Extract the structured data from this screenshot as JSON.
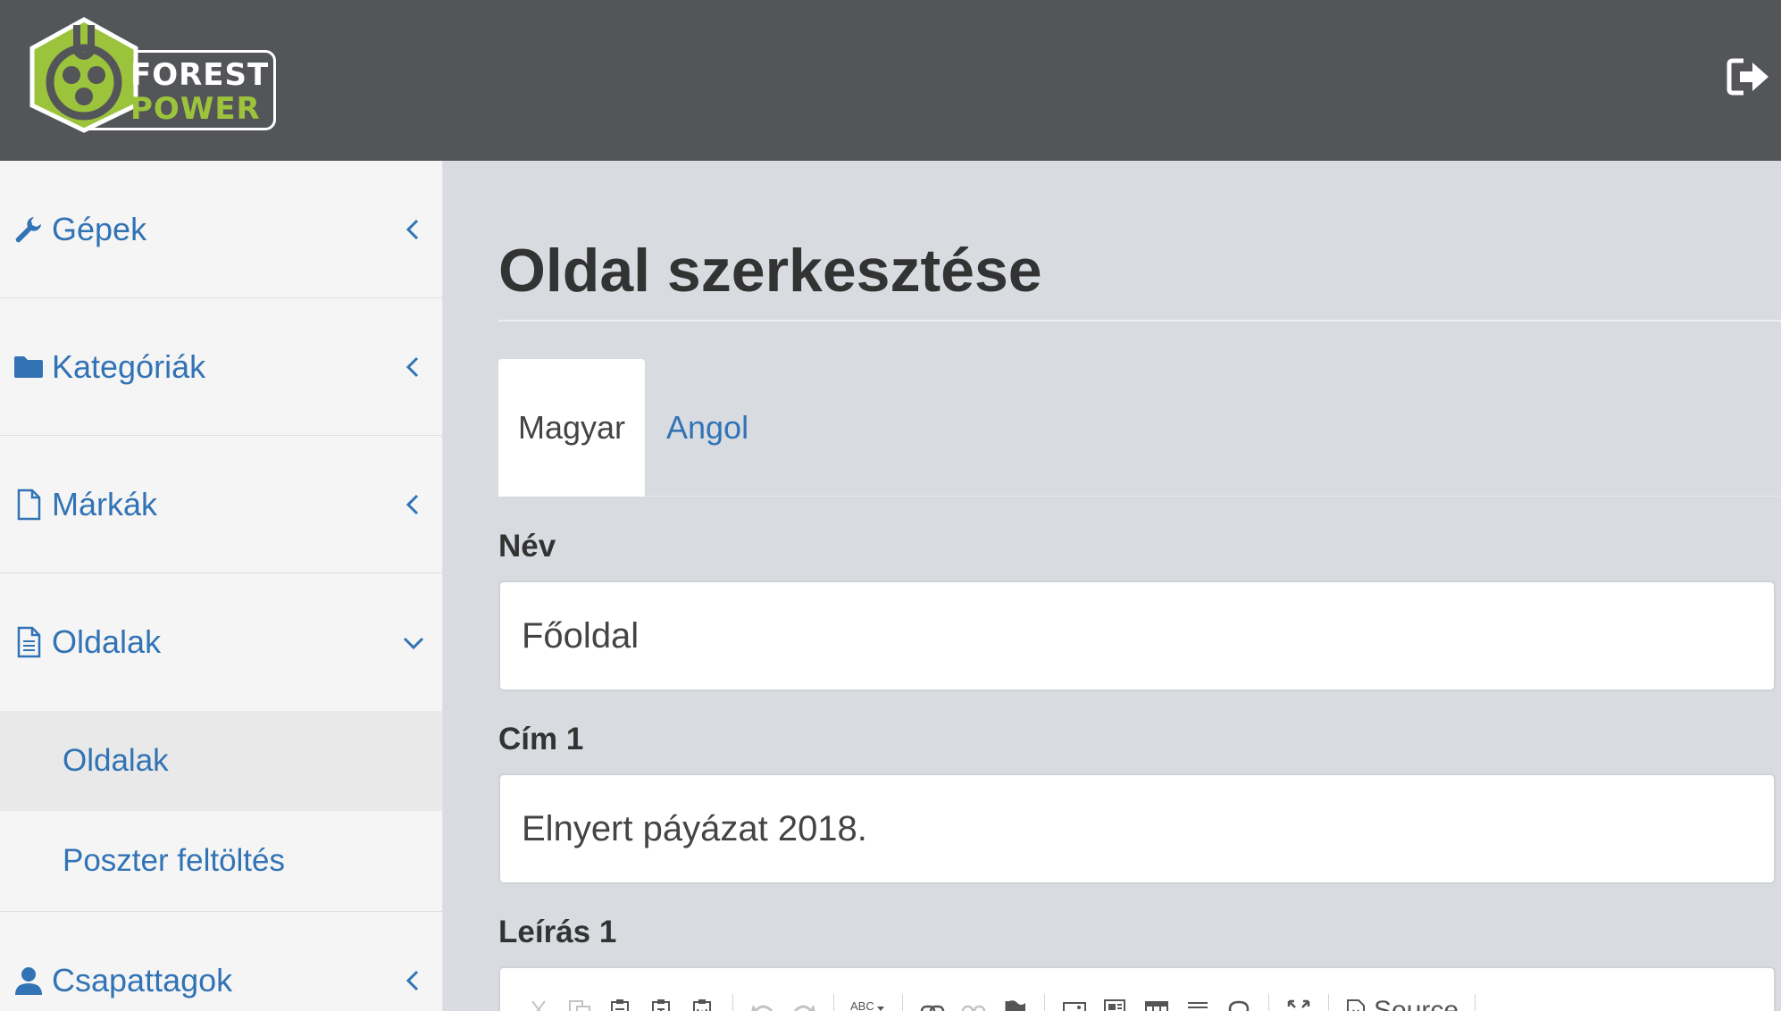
{
  "header": {
    "logo": {
      "word1": "FOREST",
      "word2": "POWER",
      "colors": {
        "green": "#9cc33c",
        "dark": "#535558"
      }
    },
    "logout_icon": "sign-out-icon"
  },
  "sidebar": {
    "items": [
      {
        "label": "Gépek",
        "icon": "wrench-icon",
        "expanded": false
      },
      {
        "label": "Kategóriák",
        "icon": "folder-icon",
        "expanded": false
      },
      {
        "label": "Márkák",
        "icon": "file-icon",
        "expanded": false
      },
      {
        "label": "Oldalak",
        "icon": "file-text-icon",
        "expanded": true,
        "children": [
          {
            "label": "Oldalak",
            "active": true
          },
          {
            "label": "Poszter feltöltés",
            "active": false
          }
        ]
      },
      {
        "label": "Csapattagok",
        "icon": "user-icon",
        "expanded": false
      }
    ]
  },
  "main": {
    "title": "Oldal szerkesztése",
    "tabs": [
      {
        "label": "Magyar",
        "active": true
      },
      {
        "label": "Angol",
        "active": false
      }
    ],
    "fields": {
      "nev": {
        "label": "Név",
        "value": "Főoldal"
      },
      "cim1": {
        "label": "Cím 1",
        "value": "Elnyert páyázat 2018."
      },
      "leiras1": {
        "label": "Leírás 1"
      }
    },
    "editor": {
      "source_label": "Source",
      "spell_label": "ABC"
    }
  },
  "colors": {
    "link": "#3273b5",
    "header_bg": "#535558",
    "content_bg": "#d8dce0",
    "sidebar_bg": "#f5f5f5"
  }
}
